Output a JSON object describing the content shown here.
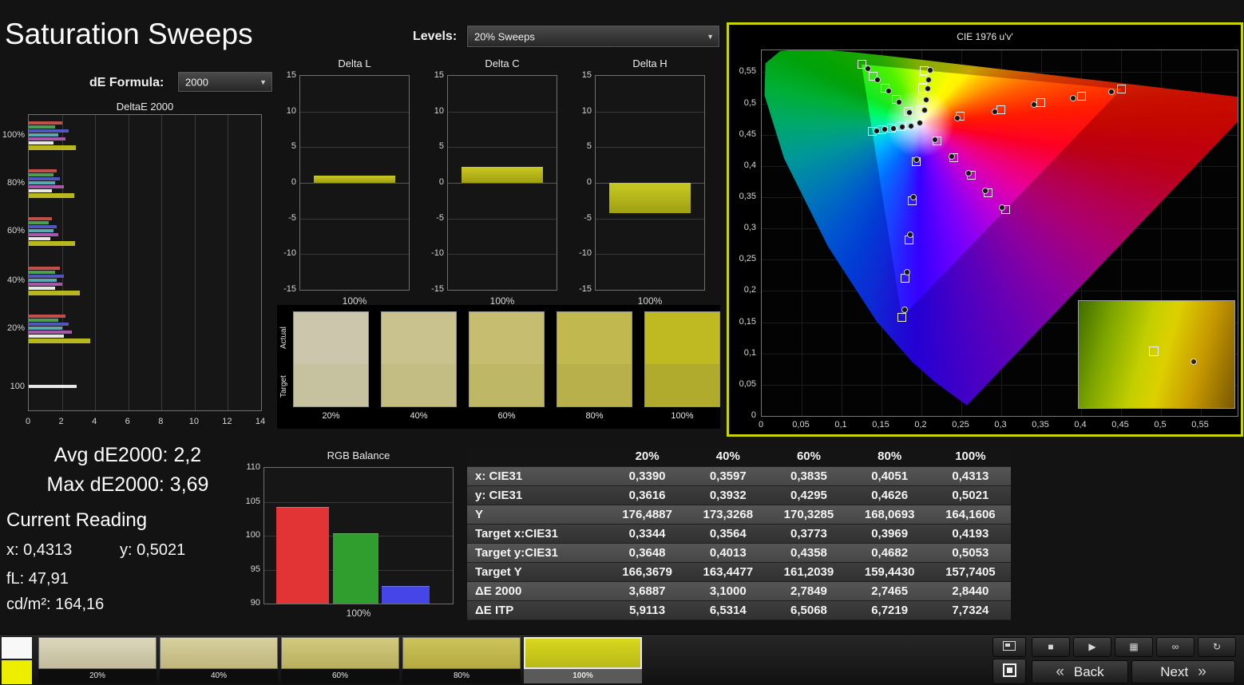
{
  "header": {
    "title": "Saturation Sweeps",
    "de_formula_label": "dE Formula:",
    "de_formula_value": "2000",
    "levels_label": "Levels:",
    "levels_value": "20% Sweeps",
    "dropdown_arrow": "▼"
  },
  "summary": {
    "avg_label": "Avg dE2000: 2,2",
    "max_label": "Max dE2000: 3,69",
    "current_reading_title": "Current Reading",
    "x_value": "x: 0,4313",
    "y_value": "y: 0,5021",
    "fl_value": "fL: 47,91",
    "cdm2_value": "cd/m²: 164,16"
  },
  "swatch_strip": {
    "row_labels": [
      "Actual",
      "Target"
    ],
    "columns": [
      {
        "label": "20%",
        "actual": "#ccc7ac",
        "target": "#c6c19e"
      },
      {
        "label": "40%",
        "actual": "#c9c28e",
        "target": "#c3bd83"
      },
      {
        "label": "60%",
        "actual": "#c6bd70",
        "target": "#bdb766"
      },
      {
        "label": "80%",
        "actual": "#c2b850",
        "target": "#b8b04a"
      },
      {
        "label": "100%",
        "actual": "#c0ba22",
        "target": "#b1ab2d"
      }
    ]
  },
  "table": {
    "headers": [
      "",
      "20%",
      "40%",
      "60%",
      "80%",
      "100%"
    ],
    "rows": [
      {
        "label": "x: CIE31",
        "values": [
          "0,3390",
          "0,3597",
          "0,3835",
          "0,4051",
          "0,4313"
        ]
      },
      {
        "label": "y: CIE31",
        "values": [
          "0,3616",
          "0,3932",
          "0,4295",
          "0,4626",
          "0,5021"
        ]
      },
      {
        "label": "Y",
        "values": [
          "176,4887",
          "173,3268",
          "170,3285",
          "168,0693",
          "164,1606"
        ]
      },
      {
        "label": "Target x:CIE31",
        "values": [
          "0,3344",
          "0,3564",
          "0,3773",
          "0,3969",
          "0,4193"
        ]
      },
      {
        "label": "Target y:CIE31",
        "values": [
          "0,3648",
          "0,4013",
          "0,4358",
          "0,4682",
          "0,5053"
        ]
      },
      {
        "label": "Target Y",
        "values": [
          "166,3679",
          "163,4477",
          "161,2039",
          "159,4430",
          "157,7405"
        ]
      },
      {
        "label": "ΔE 2000",
        "values": [
          "3,6887",
          "3,1000",
          "2,7849",
          "2,7465",
          "2,8440"
        ]
      },
      {
        "label": "ΔE ITP",
        "values": [
          "5,9113",
          "6,5314",
          "6,5068",
          "6,7219",
          "7,7324"
        ]
      }
    ]
  },
  "bottom_bar": {
    "indicator": {
      "top_color": "#f8f8f8",
      "bottom_color": "#eded00"
    },
    "patches": [
      {
        "label": "20%",
        "color_top": "#dcd6bc",
        "color_bottom": "#c2bc9c",
        "selected": false
      },
      {
        "label": "40%",
        "color_top": "#d8d09e",
        "color_bottom": "#beb67c",
        "selected": false
      },
      {
        "label": "60%",
        "color_top": "#d2ca7e",
        "color_bottom": "#b8af5e",
        "selected": false
      },
      {
        "label": "80%",
        "color_top": "#cdc45c",
        "color_bottom": "#b3aa40",
        "selected": false
      },
      {
        "label": "100%",
        "color_top": "#d8d81e",
        "color_bottom": "#b9b918",
        "selected": true
      }
    ],
    "media_buttons": [
      {
        "name": "stop",
        "glyph": "■"
      },
      {
        "name": "play",
        "glyph": "▶"
      },
      {
        "name": "grid",
        "glyph": "▦"
      },
      {
        "name": "continuous",
        "glyph": "∞"
      },
      {
        "name": "refresh",
        "glyph": "↻"
      }
    ],
    "back_chevron": "«",
    "back_label": "Back",
    "next_label": "Next",
    "next_chevron": "»"
  },
  "chart_data": [
    {
      "id": "deltae2000",
      "type": "bar",
      "orientation": "horizontal",
      "title": "DeltaE 2000",
      "groups": [
        "100%",
        "80%",
        "60%",
        "40%",
        "20%",
        "100"
      ],
      "xlim": [
        0,
        14
      ],
      "xticks": [
        0,
        2,
        4,
        6,
        8,
        10,
        12,
        14
      ],
      "series": [
        {
          "name": "red",
          "color": "#c05048",
          "values": [
            2.0,
            1.7,
            1.4,
            1.9,
            2.2,
            null
          ]
        },
        {
          "name": "green",
          "color": "#4f9e4f",
          "values": [
            1.6,
            1.5,
            1.2,
            1.6,
            1.8,
            null
          ]
        },
        {
          "name": "blue",
          "color": "#5058c0",
          "values": [
            2.4,
            1.9,
            1.7,
            2.1,
            2.4,
            null
          ]
        },
        {
          "name": "cyan",
          "color": "#58aab0",
          "values": [
            1.8,
            1.6,
            1.5,
            1.7,
            2.0,
            null
          ]
        },
        {
          "name": "magenta",
          "color": "#a858a8",
          "values": [
            2.2,
            2.1,
            1.8,
            2.0,
            2.6,
            null
          ]
        },
        {
          "name": "white",
          "color": "#e8e8e8",
          "values": [
            1.5,
            1.4,
            1.3,
            1.6,
            2.1,
            2.9
          ]
        },
        {
          "name": "yellow",
          "color": "#b8b81e",
          "values": [
            2.84,
            2.75,
            2.78,
            3.1,
            3.69,
            null
          ]
        }
      ]
    },
    {
      "id": "delta_l",
      "type": "bar",
      "title": "Delta L",
      "categories": [
        "100%"
      ],
      "values": [
        1.0
      ],
      "ylim": [
        -15,
        15
      ],
      "yticks": [
        15,
        10,
        5,
        0,
        -5,
        -10,
        -15
      ],
      "bar_color": "#b9b91d"
    },
    {
      "id": "delta_c",
      "type": "bar",
      "title": "Delta C",
      "categories": [
        "100%"
      ],
      "values": [
        2.2
      ],
      "ylim": [
        -15,
        15
      ],
      "yticks": [
        15,
        10,
        5,
        0,
        -5,
        -10,
        -15
      ],
      "bar_color": "#b9b91d"
    },
    {
      "id": "delta_h",
      "type": "bar",
      "title": "Delta H",
      "categories": [
        "100%"
      ],
      "values": [
        -4.2
      ],
      "ylim": [
        -15,
        15
      ],
      "yticks": [
        15,
        10,
        5,
        0,
        -5,
        -10,
        -15
      ],
      "bar_color": "#b9b91d"
    },
    {
      "id": "rgb_balance",
      "type": "bar",
      "title": "RGB Balance",
      "categories": [
        "100%"
      ],
      "ylim": [
        90,
        110
      ],
      "yticks": [
        110,
        105,
        100,
        95,
        90
      ],
      "series": [
        {
          "name": "red",
          "color": "#e23434",
          "value": 104.2
        },
        {
          "name": "green",
          "color": "#2f9e2f",
          "value": 100.4
        },
        {
          "name": "blue",
          "color": "#4545e8",
          "value": 92.6
        }
      ]
    },
    {
      "id": "cie",
      "type": "scatter",
      "title": "CIE 1976 u'v'",
      "xlim": [
        0,
        0.598
      ],
      "ylim": [
        0,
        0.5868
      ],
      "xticks": [
        "0",
        "0,05",
        "0,1",
        "0,15",
        "0,2",
        "0,25",
        "0,3",
        "0,35",
        "0,4",
        "0,45",
        "0,5",
        "0,55"
      ],
      "yticks": [
        "0",
        "0,05",
        "0,1",
        "0,15",
        "0,2",
        "0,25",
        "0,3",
        "0,35",
        "0,4",
        "0,45",
        "0,5",
        "0,55"
      ],
      "white_point": [
        0.1978,
        0.4683
      ],
      "locus": [
        [
          0.257,
          0.017
        ],
        [
          0.216,
          0.055
        ],
        [
          0.188,
          0.087
        ],
        [
          0.144,
          0.151
        ],
        [
          0.083,
          0.271
        ],
        [
          0.028,
          0.412
        ],
        [
          0.0035,
          0.513
        ],
        [
          0.0046,
          0.564
        ],
        [
          0.0231,
          0.5836
        ],
        [
          0.05,
          0.5868
        ],
        [
          0.079,
          0.5856
        ],
        [
          0.113,
          0.5821
        ],
        [
          0.153,
          0.5766
        ],
        [
          0.203,
          0.5694
        ],
        [
          0.262,
          0.5604
        ],
        [
          0.332,
          0.5501
        ],
        [
          0.403,
          0.5393
        ],
        [
          0.469,
          0.5296
        ],
        [
          0.52,
          0.5219
        ],
        [
          0.557,
          0.5165
        ],
        [
          0.6,
          0.5099
        ],
        [
          0.623,
          0.5065
        ]
      ],
      "gamut_triangle": [
        [
          0.125,
          0.5625
        ],
        [
          0.4507,
          0.5229
        ],
        [
          0.1754,
          0.1579
        ]
      ],
      "targets": [
        [
          0.2484,
          0.4792
        ],
        [
          0.299,
          0.4901
        ],
        [
          0.3495,
          0.5011
        ],
        [
          0.4001,
          0.512
        ],
        [
          0.4507,
          0.5229
        ],
        [
          0.1832,
          0.4871
        ],
        [
          0.1687,
          0.506
        ],
        [
          0.1541,
          0.5248
        ],
        [
          0.1396,
          0.5437
        ],
        [
          0.125,
          0.5625
        ],
        [
          0.1933,
          0.4062
        ],
        [
          0.1888,
          0.3441
        ],
        [
          0.1844,
          0.2821
        ],
        [
          0.1799,
          0.22
        ],
        [
          0.1754,
          0.1579
        ],
        [
          0.1859,
          0.4657
        ],
        [
          0.174,
          0.4631
        ],
        [
          0.1621,
          0.4606
        ],
        [
          0.1502,
          0.458
        ],
        [
          0.1383,
          0.4554
        ],
        [
          0.2192,
          0.4406
        ],
        [
          0.2407,
          0.4129
        ],
        [
          0.2621,
          0.3852
        ],
        [
          0.2836,
          0.3575
        ],
        [
          0.305,
          0.3298
        ],
        [
          0.1994,
          0.4894
        ],
        [
          0.2007,
          0.5085
        ],
        [
          0.2019,
          0.5247
        ],
        [
          0.2029,
          0.5385
        ],
        [
          0.2039,
          0.5529
        ]
      ],
      "measurements": [
        [
          0.2036,
          0.4886
        ],
        [
          0.2056,
          0.5056
        ],
        [
          0.2077,
          0.5233
        ],
        [
          0.2093,
          0.5378
        ],
        [
          0.2114,
          0.5536
        ],
        [
          0.245,
          0.476
        ],
        [
          0.292,
          0.487
        ],
        [
          0.341,
          0.498
        ],
        [
          0.39,
          0.508
        ],
        [
          0.438,
          0.518
        ],
        [
          0.185,
          0.485
        ],
        [
          0.172,
          0.502
        ],
        [
          0.159,
          0.52
        ],
        [
          0.145,
          0.538
        ],
        [
          0.133,
          0.556
        ],
        [
          0.194,
          0.41
        ],
        [
          0.19,
          0.35
        ],
        [
          0.186,
          0.29
        ],
        [
          0.182,
          0.23
        ],
        [
          0.179,
          0.17
        ],
        [
          0.187,
          0.464
        ],
        [
          0.176,
          0.462
        ],
        [
          0.165,
          0.46
        ],
        [
          0.154,
          0.458
        ],
        [
          0.144,
          0.456
        ],
        [
          0.217,
          0.442
        ],
        [
          0.238,
          0.415
        ],
        [
          0.259,
          0.388
        ],
        [
          0.28,
          0.36
        ],
        [
          0.301,
          0.333
        ],
        [
          0.1978,
          0.4683
        ]
      ],
      "inset": {
        "target": [
          0.48,
          0.47
        ],
        "measured": [
          0.74,
          0.57
        ]
      }
    }
  ]
}
